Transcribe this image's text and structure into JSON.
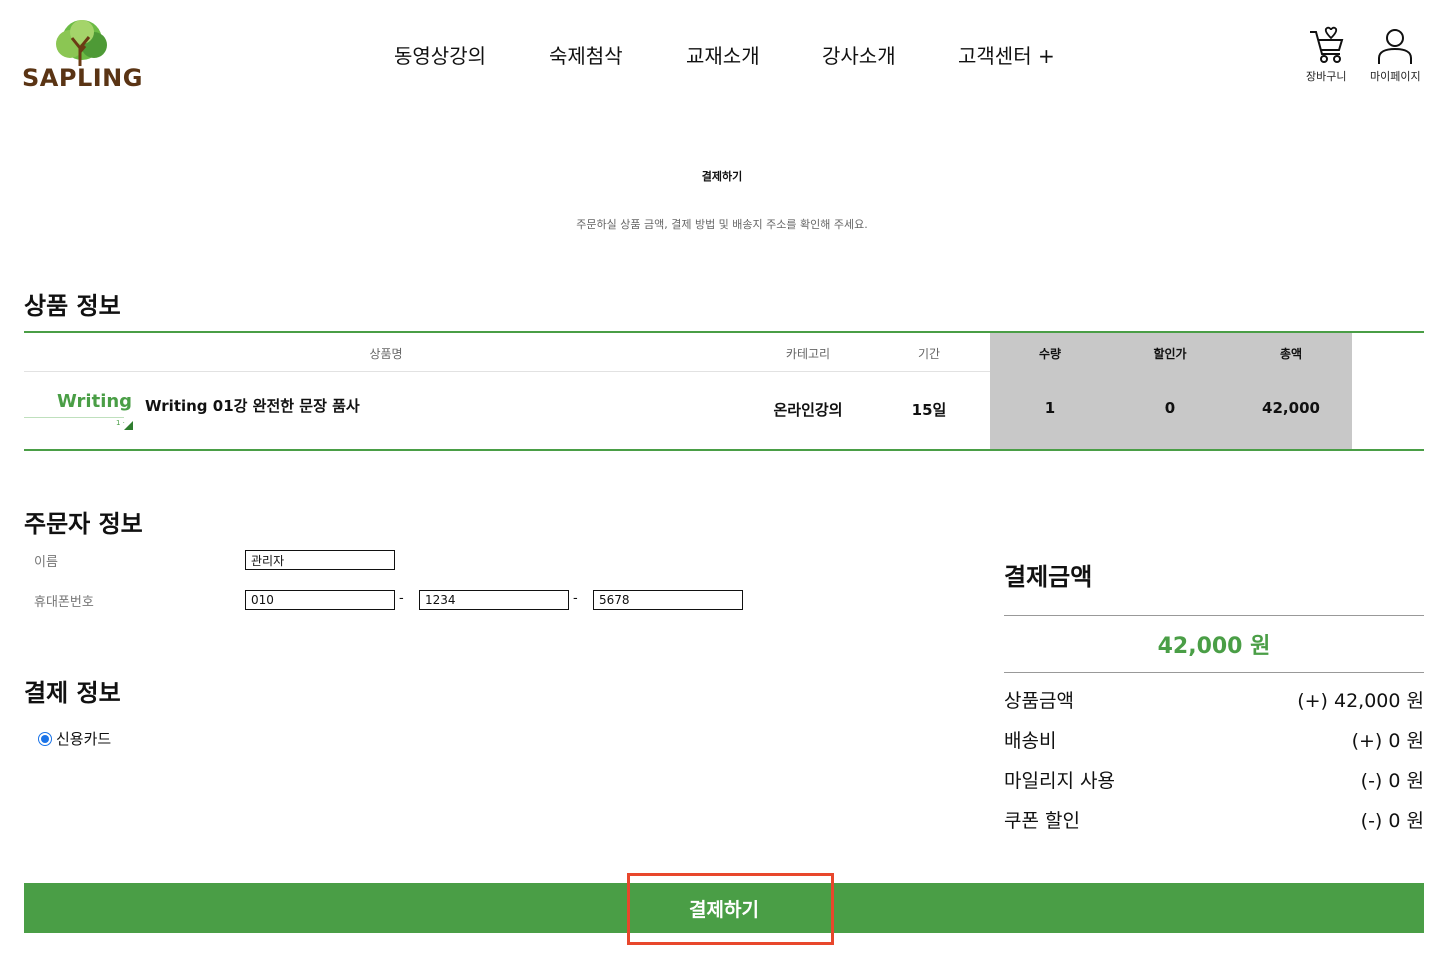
{
  "header": {
    "logo_text": "SAPLING",
    "nav": [
      "동영상강의",
      "숙제첨삭",
      "교재소개",
      "강사소개",
      "고객센터 +"
    ],
    "cart_label": "장바구니",
    "mypage_label": "마이페이지"
  },
  "page": {
    "title": "결제하기",
    "subtitle": "주문하실 상품 금액, 결제 방법 및 배송지 주소를 확인해 주세요."
  },
  "product_section": {
    "heading": "상품 정보",
    "columns": [
      "상품명",
      "카테고리",
      "기간",
      "수량",
      "할인가",
      "총액"
    ],
    "row": {
      "thumb_label": "Writing",
      "thumb_small": "1 ·",
      "name": "Writing 01강 완전한 문장 품사",
      "category": "온라인강의",
      "period": "15일",
      "quantity": "1",
      "discount": "0",
      "total": "42,000"
    }
  },
  "orderer_section": {
    "heading": "주문자 정보",
    "name_label": "이름",
    "name_value": "관리자",
    "phone_label": "휴대폰번호",
    "phone1": "010",
    "phone2": "1234",
    "phone3": "5678",
    "dash": "-"
  },
  "payment_section": {
    "heading": "결제 정보",
    "method": "신용카드"
  },
  "summary": {
    "title": "결제금액",
    "total": "42,000 원",
    "rows": [
      {
        "label": "상품금액",
        "value": "(+) 42,000 원"
      },
      {
        "label": "배송비",
        "value": "(+) 0 원"
      },
      {
        "label": "마일리지 사용",
        "value": "(-) 0 원"
      },
      {
        "label": "쿠폰 할인",
        "value": "(-) 0 원"
      }
    ]
  },
  "pay_button": "결제하기",
  "colors": {
    "brand_green": "#4a9e46",
    "logo_brown": "#5a3414",
    "highlight_red": "#e8472c",
    "table_gray": "#c8c8c8"
  }
}
